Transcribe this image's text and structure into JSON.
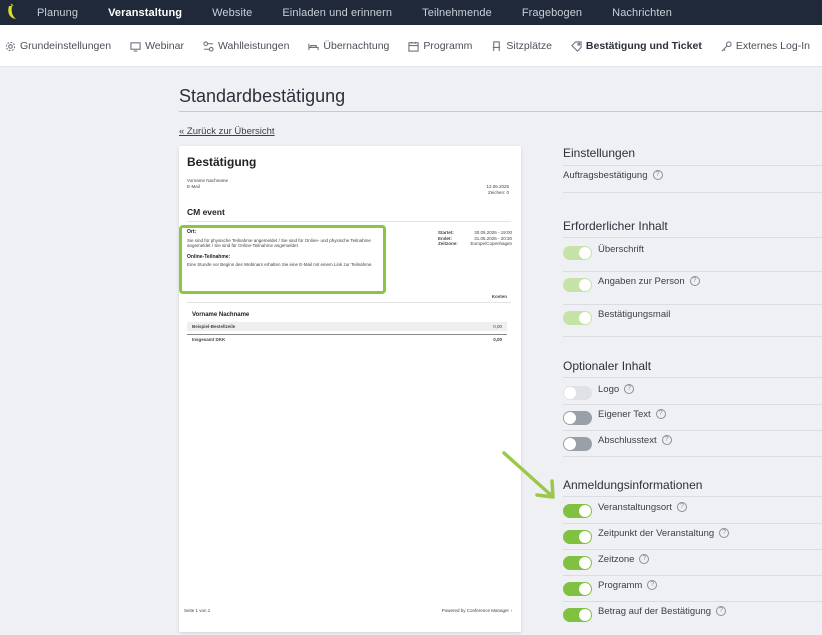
{
  "topnav": [
    "Planung",
    "Veranstaltung",
    "Website",
    "Einladen und erinnern",
    "Teilnehmende",
    "Fragebogen",
    "Nachrichten"
  ],
  "subnav": [
    {
      "label": "Grundeinstellungen",
      "icon": "gear-icon"
    },
    {
      "label": "Webinar",
      "icon": "monitor-icon"
    },
    {
      "label": "Wahlleistungen",
      "icon": "options-icon"
    },
    {
      "label": "Übernachtung",
      "icon": "bed-icon"
    },
    {
      "label": "Programm",
      "icon": "calendar-icon"
    },
    {
      "label": "Sitzplätze",
      "icon": "seat-icon"
    },
    {
      "label": "Bestätigung und Ticket",
      "icon": "ticket-icon"
    },
    {
      "label": "Externes Log-In",
      "icon": "key-icon"
    }
  ],
  "page": {
    "title": "Standardbestätigung",
    "back_link": "« Zurück zur Übersicht"
  },
  "preview": {
    "title": "Bestätigung",
    "name_line": "Vorname Nachname",
    "email_line": "E-Mail",
    "date": "12.06.2025",
    "zeichen": "Zeichen: 0",
    "event": "CM event",
    "ort_label": "Ort:",
    "ort_text": "Sie sind für physische Teilnahme angemeldet / Sie sind für Online- und physische Teilnahme angemeldet / Sie sind für Online-Teilnahme angemeldet",
    "online_label": "Online-Teilnahme:",
    "online_text": "Eine Stunde vor Beginn des Webinars erhalten Sie eine E-Mail mit einem Link zur Teilnahme.",
    "start_label": "Startet:",
    "start_value": "30.05.2026 - 19:00",
    "end_label": "Endet:",
    "end_value": "31.05.2026 - 20:30",
    "tz_label": "Zeitzone:",
    "tz_value": "Europe/Copenhagen",
    "kosten": "Kosten",
    "person": "Vorname Nachname",
    "item_label": "Beispiel-Bestellzeile",
    "item_value": "0,00",
    "total_label": "Insgesamt DKK",
    "total_value": "0,00",
    "page_num": "Seite 1 von 1",
    "powered": "Powered by Conference Manager"
  },
  "settings": {
    "einstellungen": {
      "title": "Einstellungen",
      "auftrag": "Auftragsbestätigung"
    },
    "erforderlich": {
      "title": "Erforderlicher Inhalt",
      "items": [
        {
          "label": "Überschrift",
          "state": "on-fixed"
        },
        {
          "label": "Angaben zur Person",
          "state": "on-fixed"
        },
        {
          "label": "Bestätigungsmail",
          "state": "on-fixed"
        }
      ]
    },
    "optional": {
      "title": "Optionaler Inhalt",
      "items": [
        {
          "label": "Logo",
          "state": "off-fixed"
        },
        {
          "label": "Eigener Text",
          "state": "off"
        },
        {
          "label": "Abschlusstext",
          "state": "off"
        }
      ]
    },
    "anmeldung": {
      "title": "Anmeldungsinformationen",
      "items": [
        {
          "label": "Veranstaltungsort",
          "state": "on"
        },
        {
          "label": "Zeitpunkt der Veranstaltung",
          "state": "on"
        },
        {
          "label": "Zeitzone",
          "state": "on"
        },
        {
          "label": "Programm",
          "state": "on"
        },
        {
          "label": "Betrag auf der Bestätigung",
          "state": "on"
        }
      ]
    }
  },
  "colors": {
    "accent": "#80c141",
    "nav_bg": "#20293a",
    "highlight": "#8cc63e"
  }
}
